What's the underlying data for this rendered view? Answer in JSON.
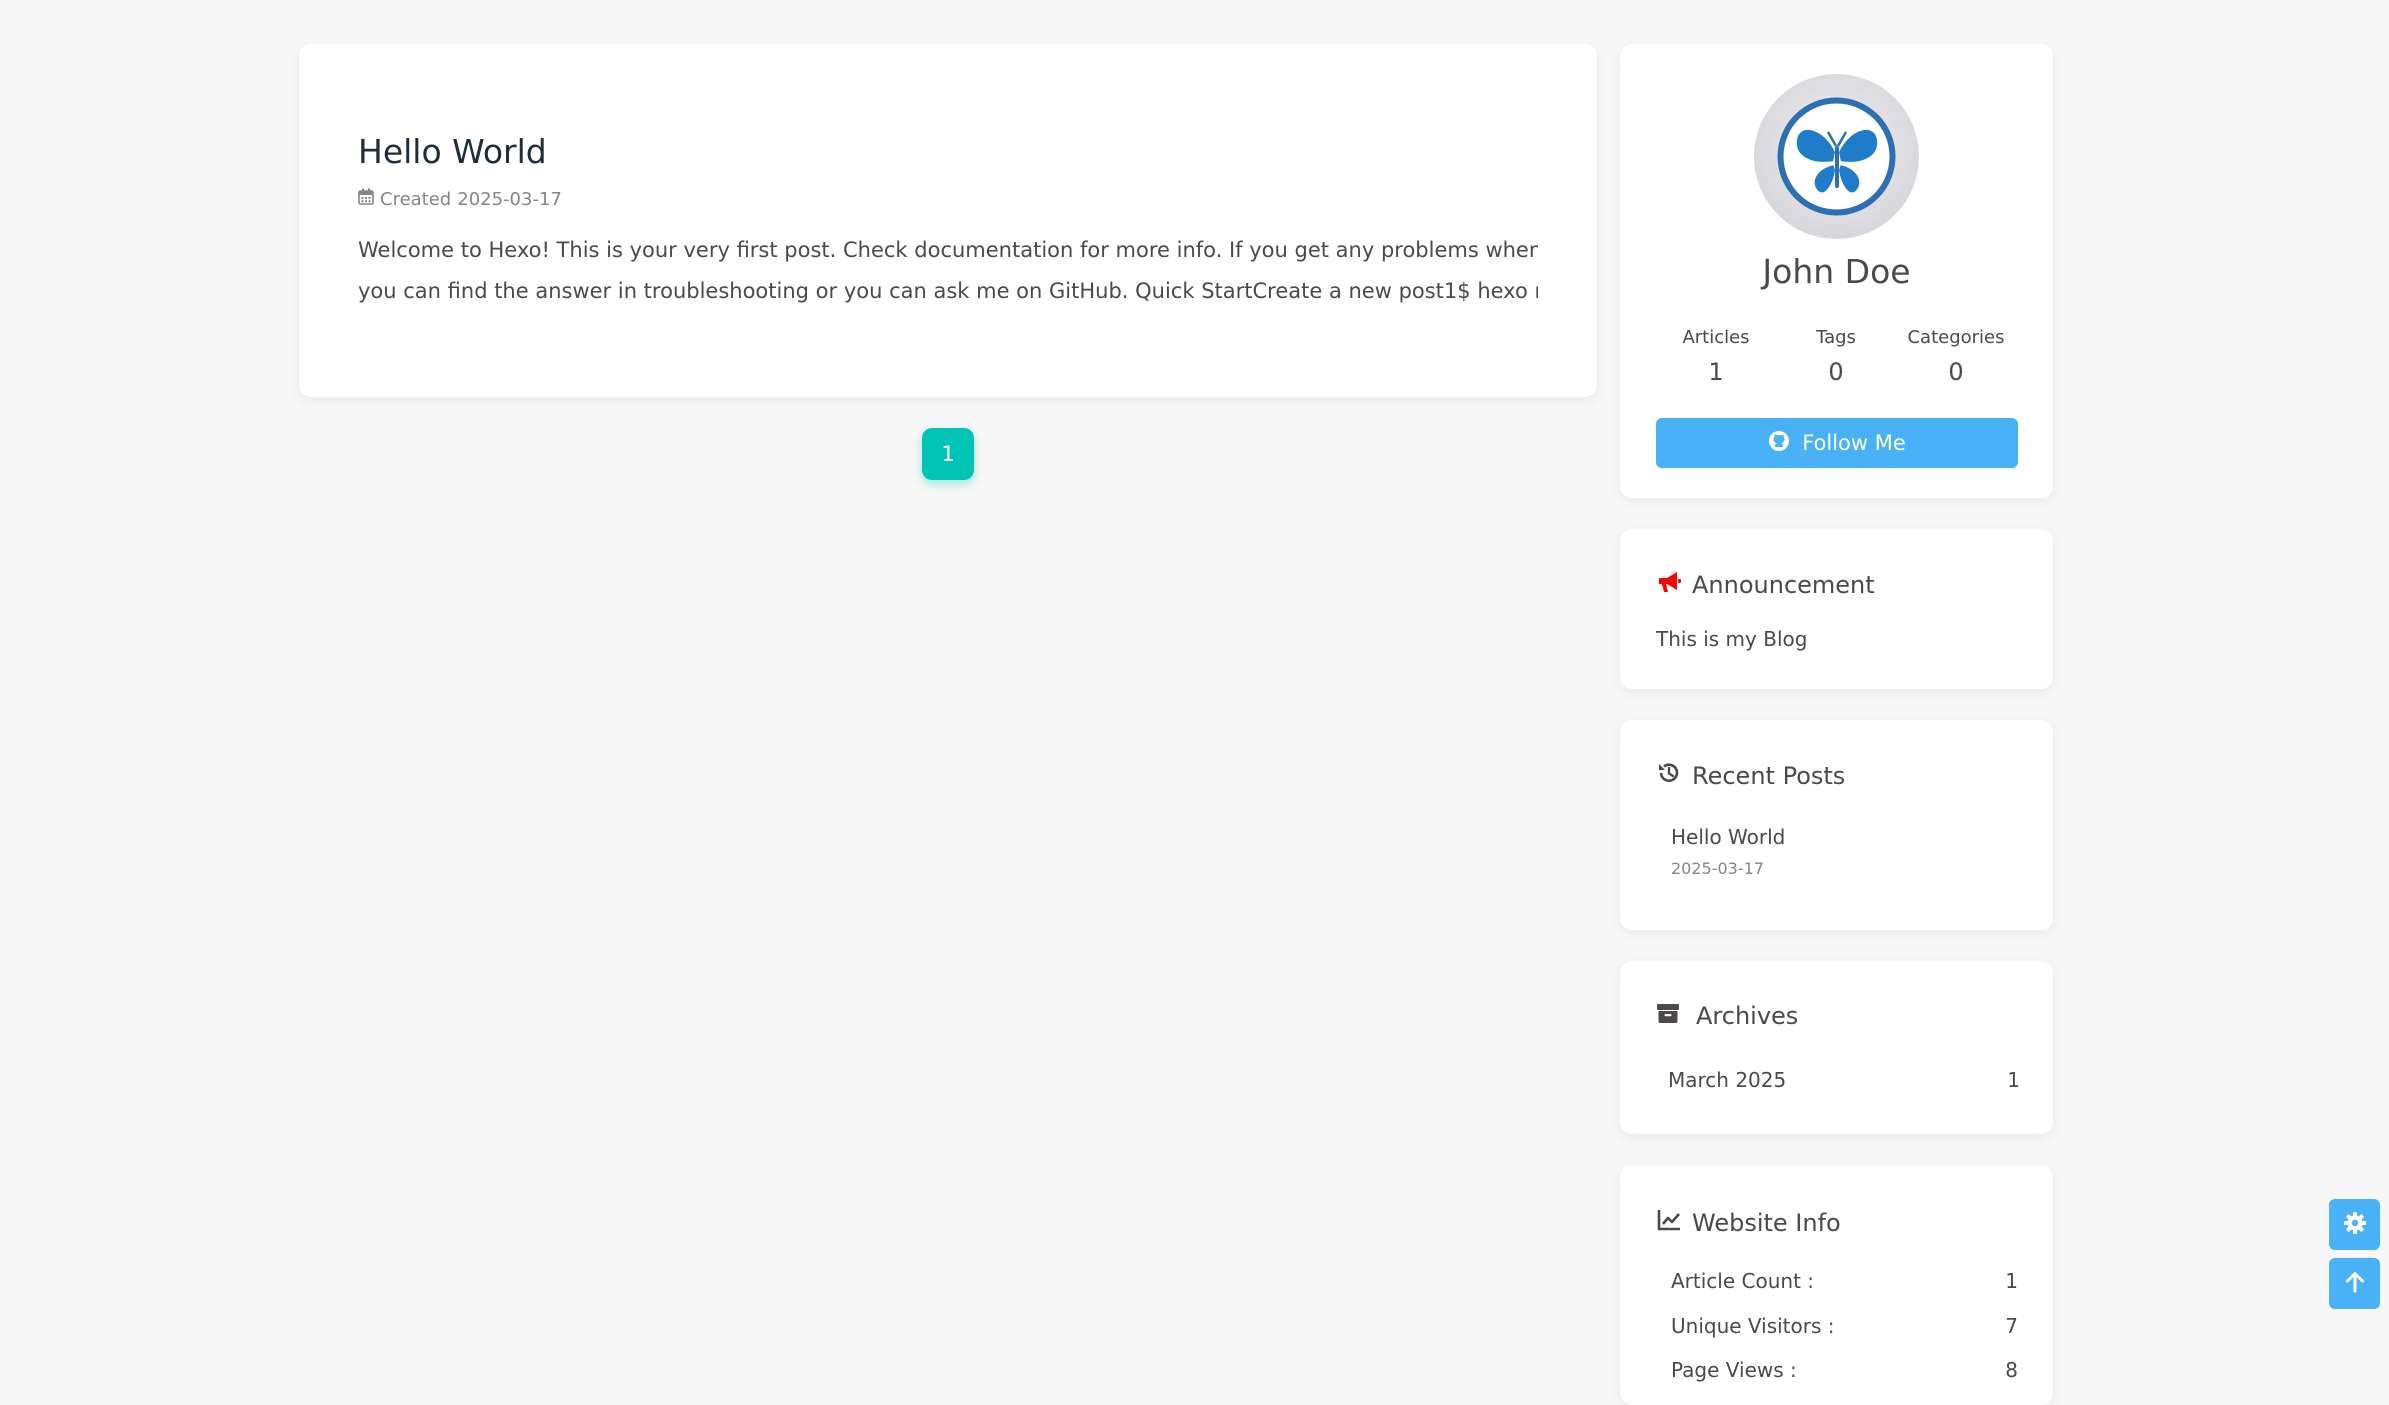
{
  "post": {
    "title": "Hello World",
    "created_label": "Created",
    "created_date": "2025-03-17",
    "excerpt_line1": "Welcome to Hexo! This is your very first post. Check documentation for more info. If you get any problems when using Hexo,",
    "excerpt_line2": "you can find the answer in troubleshooting or you can ask me on GitHub. Quick StartCreate a new post1$ hexo new \"My New..."
  },
  "pagination": {
    "current": "1"
  },
  "author": {
    "name": "John Doe",
    "stats": [
      {
        "label": "Articles",
        "value": "1"
      },
      {
        "label": "Tags",
        "value": "0"
      },
      {
        "label": "Categories",
        "value": "0"
      }
    ],
    "follow_label": "Follow Me"
  },
  "announcement": {
    "title": "Announcement",
    "text": "This is my Blog"
  },
  "recent_posts": {
    "title": "Recent Posts",
    "items": [
      {
        "title": "Hello World",
        "date": "2025-03-17"
      }
    ]
  },
  "archives": {
    "title": "Archives",
    "items": [
      {
        "label": "March 2025",
        "count": "1"
      }
    ]
  },
  "website_info": {
    "title": "Website Info",
    "rows": [
      {
        "label": "Article Count :",
        "value": "1"
      },
      {
        "label": "Unique Visitors :",
        "value": "7"
      },
      {
        "label": "Page Views :",
        "value": "8"
      }
    ]
  },
  "colors": {
    "accent": "#49b1f5",
    "pagination": "#00c4b6",
    "announcement_icon": "#ff0000"
  },
  "icons": [
    "calendar-icon",
    "github-icon",
    "bullhorn-icon",
    "history-icon",
    "archive-icon",
    "chart-line-icon",
    "gear-icon",
    "arrow-up-icon"
  ]
}
